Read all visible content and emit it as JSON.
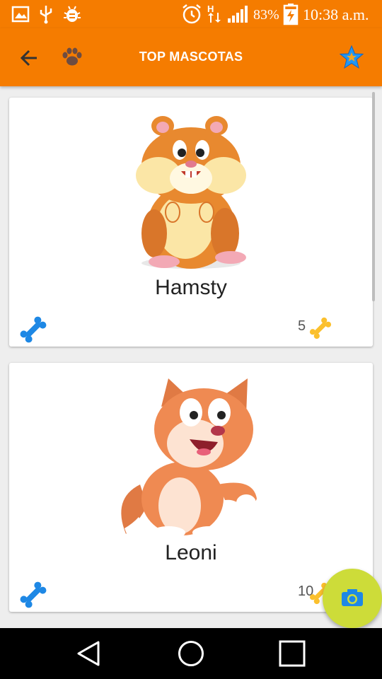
{
  "status_bar": {
    "battery_percent": "83%",
    "time": "10:38 a.m.",
    "icons": [
      "image-icon",
      "usb-icon",
      "android-debug-icon",
      "alarm-icon",
      "data-transfer-icon",
      "signal-icon",
      "battery-charging-icon"
    ]
  },
  "app_bar": {
    "title": "TOP MASCOTAS",
    "back_icon": "arrow-back-icon",
    "paw_icon": "paw-icon",
    "star_icon": "star-icon"
  },
  "pets": [
    {
      "name": "Hamsty",
      "likes": "5",
      "image": "hamster-illustration"
    },
    {
      "name": "Leoni",
      "likes": "10",
      "image": "cat-illustration"
    }
  ],
  "fab": {
    "icon": "camera-icon"
  },
  "colors": {
    "primary": "#f57c00",
    "accent": "#cddc39",
    "bone_blue": "#1e88e5",
    "bone_yellow": "#fbc02d",
    "star_blue": "#2196f3"
  },
  "nav_bar": {
    "buttons": [
      "back-triangle-icon",
      "home-circle-icon",
      "recents-square-icon"
    ]
  }
}
